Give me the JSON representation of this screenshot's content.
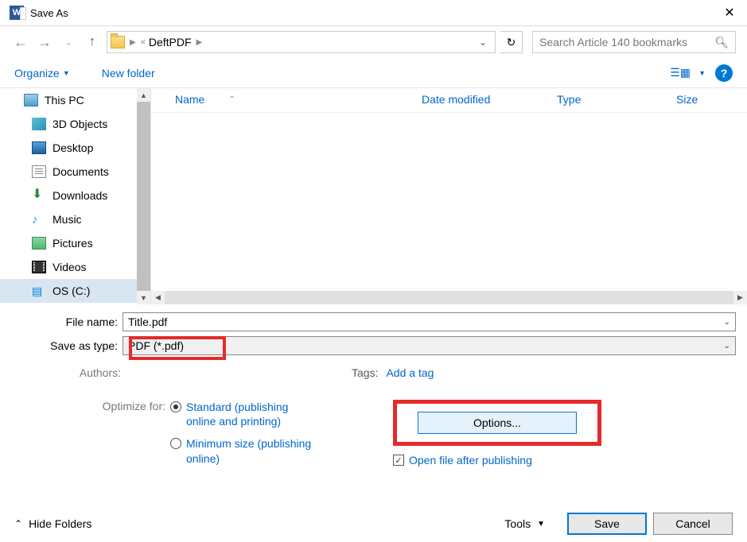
{
  "title": "Save As",
  "breadcrumb": {
    "item1": "DeftPDF"
  },
  "search_placeholder": "Search Article 140 bookmarks",
  "toolbar": {
    "organize": "Organize",
    "new_folder": "New folder"
  },
  "sidebar": {
    "this_pc": "This PC",
    "objects_3d": "3D Objects",
    "desktop": "Desktop",
    "documents": "Documents",
    "downloads": "Downloads",
    "music": "Music",
    "pictures": "Pictures",
    "videos": "Videos",
    "os_c": "OS (C:)"
  },
  "columns": {
    "name": "Name",
    "date": "Date modified",
    "type": "Type",
    "size": "Size"
  },
  "form": {
    "filename_label": "File name:",
    "filename_value": "Title.pdf",
    "saveastype_label": "Save as type:",
    "saveastype_value": "PDF (*.pdf)",
    "authors_label": "Authors:",
    "tags_label": "Tags:",
    "add_tag": "Add a tag",
    "optimize_label": "Optimize for:",
    "radio_standard": "Standard (publishing online and printing)",
    "radio_minimum": "Minimum size (publishing online)",
    "options_btn": "Options...",
    "open_after": "Open file after publishing"
  },
  "footer": {
    "hide_folders": "Hide Folders",
    "tools": "Tools",
    "save": "Save",
    "cancel": "Cancel"
  }
}
